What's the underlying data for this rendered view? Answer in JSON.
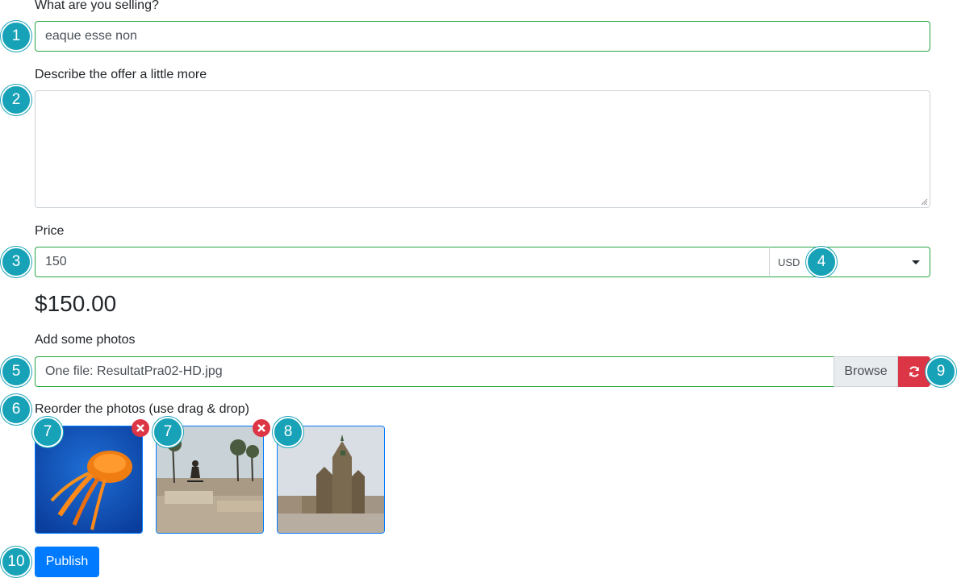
{
  "form": {
    "title_label": "What are you selling?",
    "title_value": "eaque esse non",
    "description_label": "Describe the offer a little more",
    "description_value": "",
    "price_label": "Price",
    "price_value": "150",
    "currency_value": "USD",
    "price_formatted": "$150.00",
    "photos_label": "Add some photos",
    "file_status": "One file: ResultatPra02-HD.jpg",
    "browse_label": "Browse",
    "reorder_label": "Reorder the photos (use drag & drop)",
    "publish_label": "Publish"
  },
  "photos": [
    {
      "subject": "jellyfish",
      "removable": true
    },
    {
      "subject": "skatepark",
      "removable": true
    },
    {
      "subject": "cathedral",
      "removable": false
    }
  ],
  "badges": [
    "1",
    "2",
    "3",
    "4",
    "5",
    "6",
    "7",
    "7",
    "8",
    "9",
    "10"
  ],
  "icons": {
    "reset": "refresh-icon",
    "remove": "close-circle-icon",
    "dropdown": "caret-down-icon"
  },
  "colors": {
    "valid_border": "#28a745",
    "primary": "#007bff",
    "danger": "#dc3545",
    "badge": "#17a2b8"
  }
}
